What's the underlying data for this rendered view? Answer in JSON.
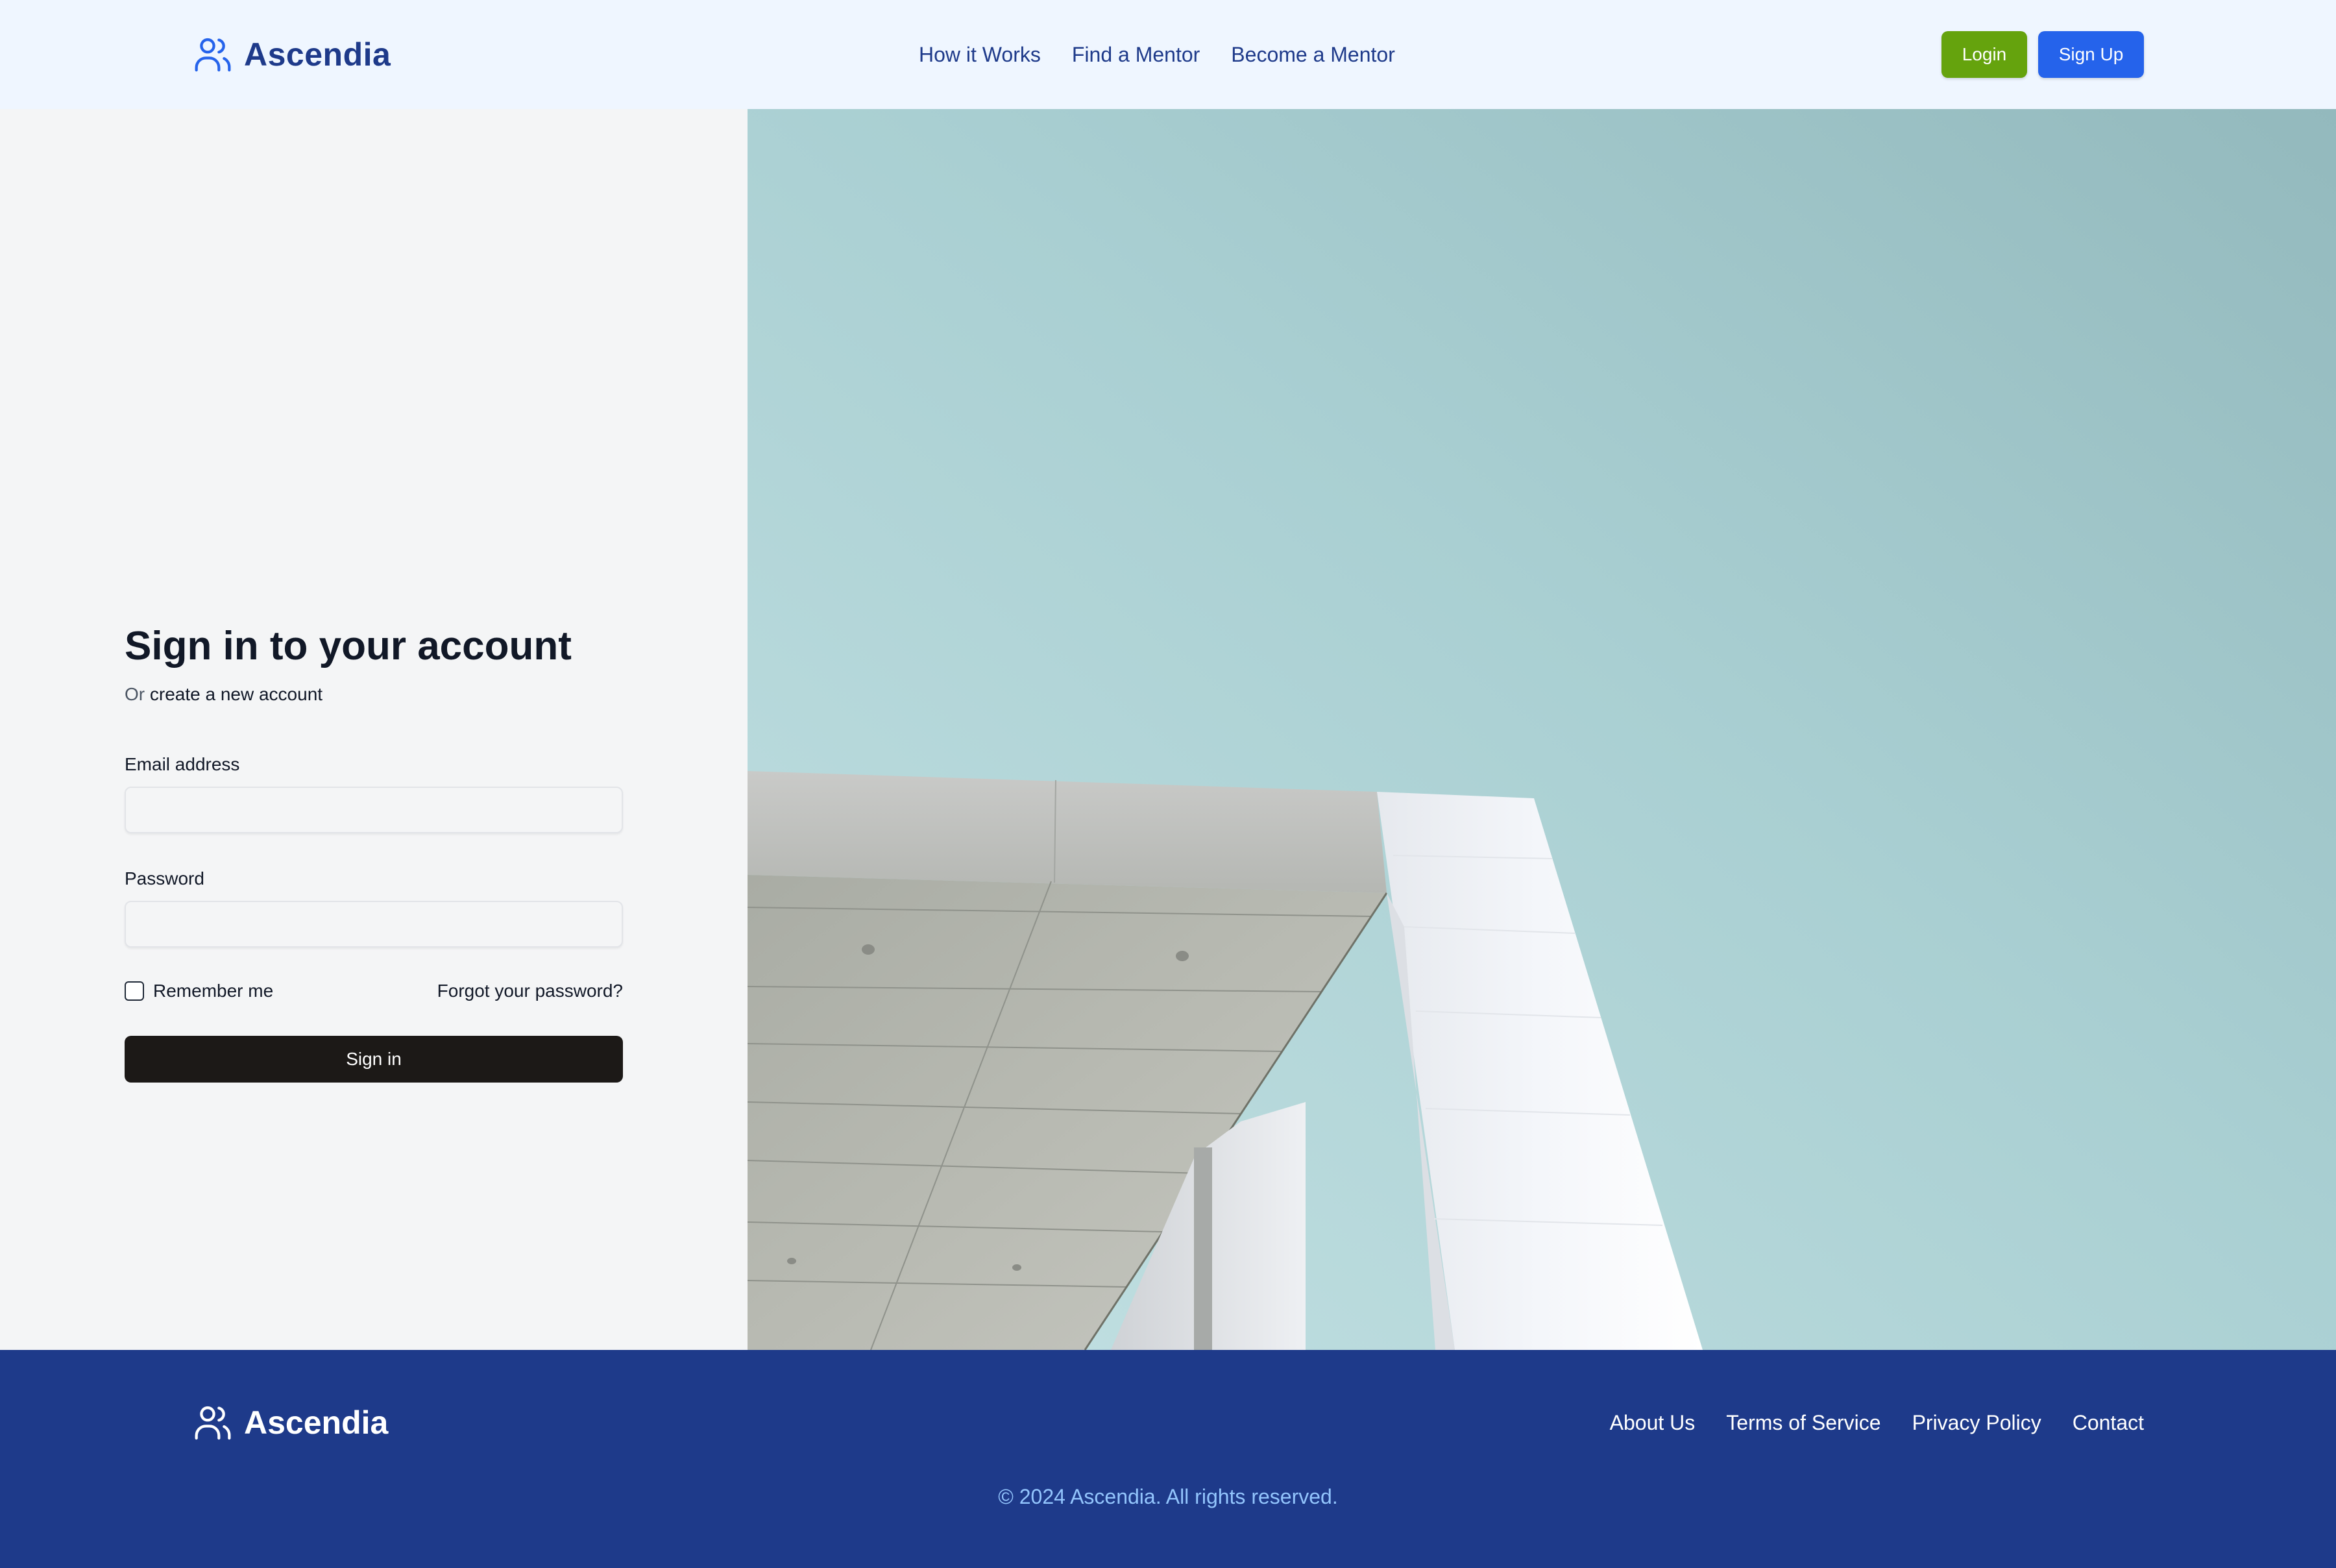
{
  "header": {
    "brand": "Ascendia",
    "nav": [
      "How it Works",
      "Find a Mentor",
      "Become a Mentor"
    ],
    "login_label": "Login",
    "signup_label": "Sign Up"
  },
  "signin": {
    "title": "Sign in to your account",
    "subtitle_prefix": "Or",
    "subtitle_link": "create a new account",
    "email_label": "Email address",
    "email_value": "",
    "password_label": "Password",
    "password_value": "",
    "remember_label": "Remember me",
    "forgot_label": "Forgot your password?",
    "submit_label": "Sign in"
  },
  "footer": {
    "brand": "Ascendia",
    "links": [
      "About Us",
      "Terms of Service",
      "Privacy Policy",
      "Contact"
    ],
    "copyright": "© 2024 Ascendia. All rights reserved."
  },
  "icons": {
    "logo": "users-icon"
  },
  "colors": {
    "brand_navy": "#1e3a8a",
    "login_green": "#65a30d",
    "signup_blue": "#2563eb",
    "signin_dark": "#1c1917",
    "header_bg": "#eff6ff"
  }
}
